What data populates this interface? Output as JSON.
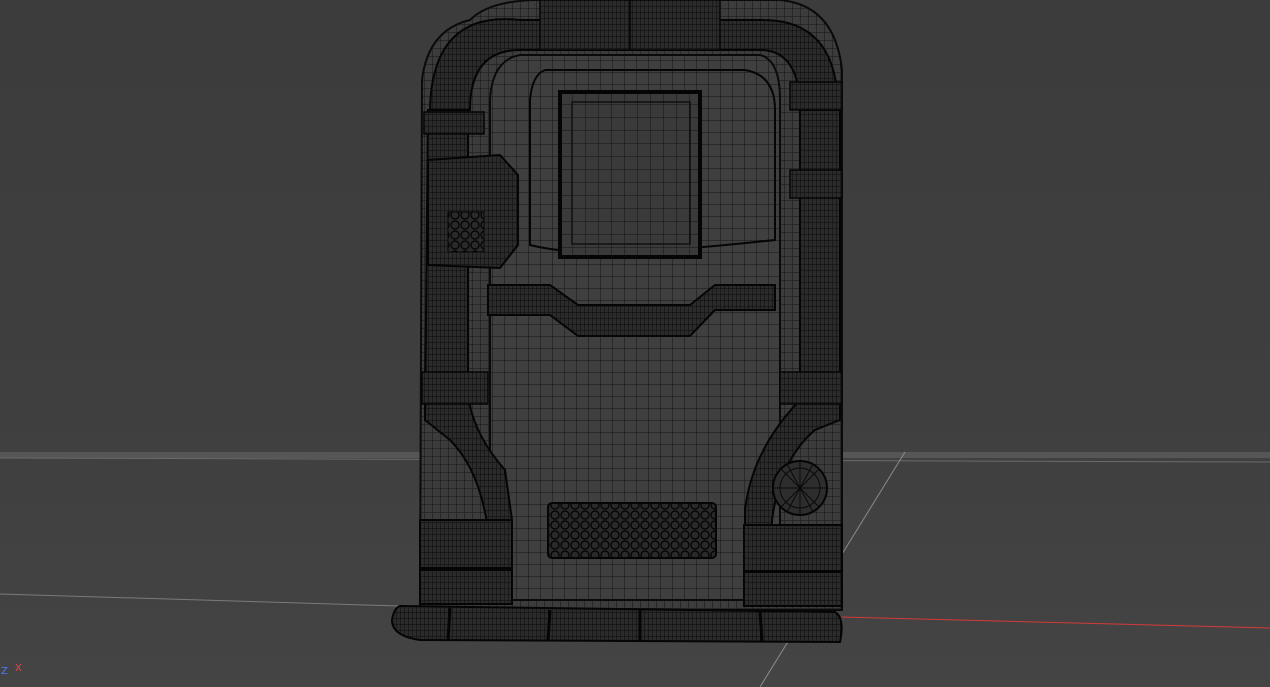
{
  "viewport": {
    "background_color": "#3f3f3f",
    "object": "door-wireframe-mesh",
    "view": "perspective"
  },
  "axis_gizmo": {
    "z_label": "Z",
    "x_label": "X",
    "z_color": "#4a7ef0",
    "x_color": "#e24a4a"
  },
  "colors": {
    "mesh_fill": "#3c3c3c",
    "wire": "#101010",
    "horizon": "#5a5a5a",
    "x_axis": "#d43a3a"
  }
}
